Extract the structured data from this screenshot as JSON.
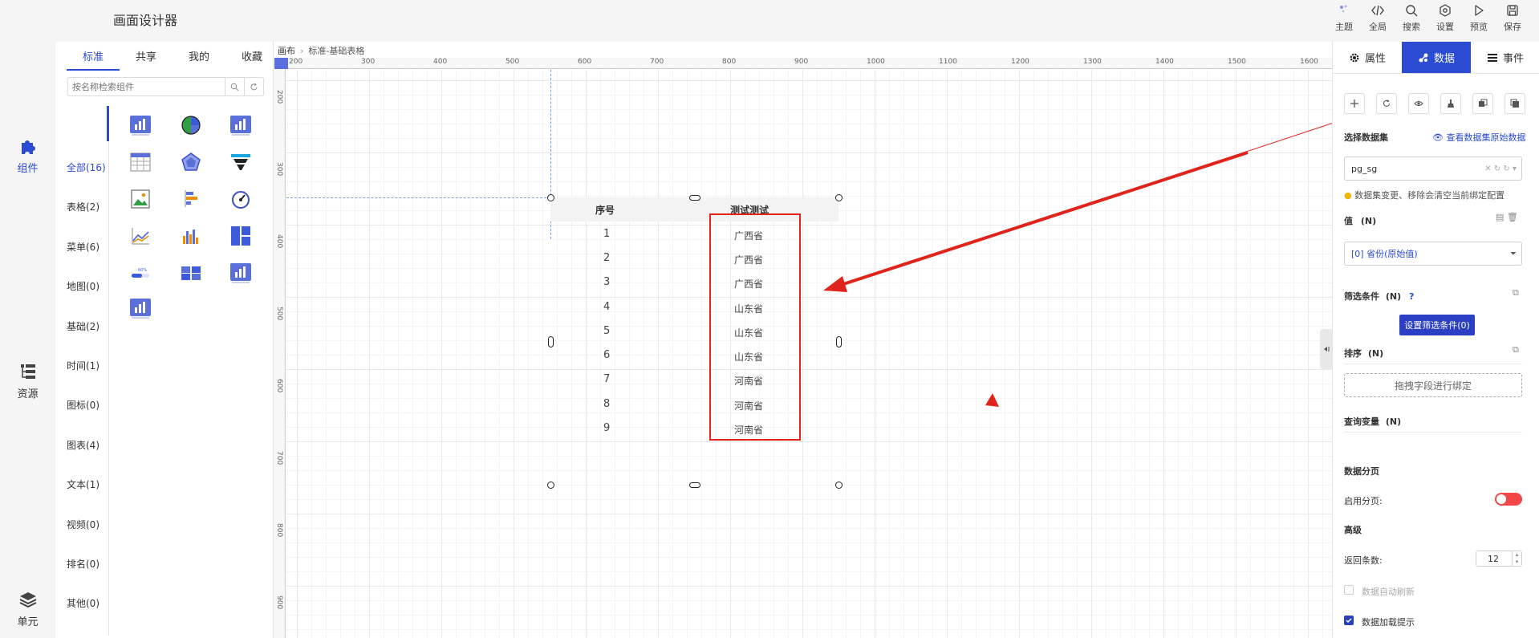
{
  "header": {
    "title": "画面设计器",
    "tools": [
      {
        "label": "主题",
        "icon": "theme-icon"
      },
      {
        "label": "全局",
        "icon": "code-icon"
      },
      {
        "label": "搜索",
        "icon": "search-icon"
      },
      {
        "label": "设置",
        "icon": "settings-icon"
      },
      {
        "label": "预览",
        "icon": "play-icon"
      },
      {
        "label": "保存",
        "icon": "save-icon"
      }
    ]
  },
  "leftnav": [
    {
      "label": "组件",
      "icon": "puzzle-icon"
    },
    {
      "label": "资源",
      "icon": "resource-icon"
    },
    {
      "label": "单元",
      "icon": "layers-icon"
    }
  ],
  "components": {
    "tabs": [
      "标准",
      "共享",
      "我的",
      "收藏"
    ],
    "search_placeholder": "按名称检索组件",
    "categories": [
      "全部(16)",
      "表格(2)",
      "菜单(6)",
      "地图(0)",
      "基础(2)",
      "时间(1)",
      "图标(0)",
      "图表(4)",
      "文本(1)",
      "视频(0)",
      "排名(0)",
      "其他(0)"
    ],
    "icons": [
      "bar-chart-icon",
      "pie-chart-icon",
      "bar-chart-icon",
      "table-icon",
      "radar-chart-icon",
      "funnel-chart-icon",
      "image-icon",
      "horizontal-bar-icon",
      "gauge-icon",
      "line-chart-icon",
      "multi-bar-icon",
      "layout-icon",
      "progress-icon",
      "grid-icon",
      "bar-chart-icon",
      "bar-chart-icon"
    ]
  },
  "canvas": {
    "breadcrumb_root": "画布",
    "breadcrumb_current": "标准-基础表格",
    "ruler_x": [
      "200",
      "300",
      "400",
      "500",
      "600",
      "700",
      "800",
      "900",
      "1000",
      "1100",
      "1200",
      "1300",
      "1400",
      "1500",
      "1600"
    ],
    "ruler_y": [
      "200",
      "300",
      "400",
      "500",
      "600",
      "700",
      "800",
      "900"
    ]
  },
  "table_widget": {
    "headers": [
      "序号",
      "测试测试"
    ],
    "rows": [
      [
        "1",
        "广西省"
      ],
      [
        "2",
        "广西省"
      ],
      [
        "3",
        "广西省"
      ],
      [
        "4",
        "山东省"
      ],
      [
        "5",
        "山东省"
      ],
      [
        "6",
        "山东省"
      ],
      [
        "7",
        "河南省"
      ],
      [
        "8",
        "河南省"
      ],
      [
        "9",
        "河南省"
      ]
    ]
  },
  "right_panel": {
    "tabs": [
      {
        "label": "属性",
        "icon": "gear-icon"
      },
      {
        "label": "数据",
        "icon": "data-icon"
      },
      {
        "label": "事件",
        "icon": "list-icon"
      }
    ],
    "dataset_label": "选择数据集",
    "view_raw_link": "查看数据集原始数据",
    "dataset_value": "pg_sg",
    "dataset_warning": "数据集变更、移除会清空当前绑定配置",
    "value_label": "值",
    "value_tag": "(N)",
    "value_field": "[0] 省份(原始值)",
    "filter_label": "筛选条件",
    "filter_tag": "(N)",
    "filter_button": "设置筛选条件(0)",
    "sort_label": "排序",
    "sort_tag": "(N)",
    "sort_drop": "拖拽字段进行绑定",
    "query_label": "查询变量",
    "query_tag": "(N)",
    "pagination_label": "数据分页",
    "enable_pagination": "启用分页:",
    "advanced_label": "高级",
    "return_count_label": "返回条数:",
    "return_count_value": "12",
    "auto_refresh": "数据自动刷新",
    "load_hint": "数据加载提示"
  },
  "colors": {
    "accent": "#2b4bd3",
    "annotation": "#e0241b",
    "toggle": "#f04848"
  }
}
